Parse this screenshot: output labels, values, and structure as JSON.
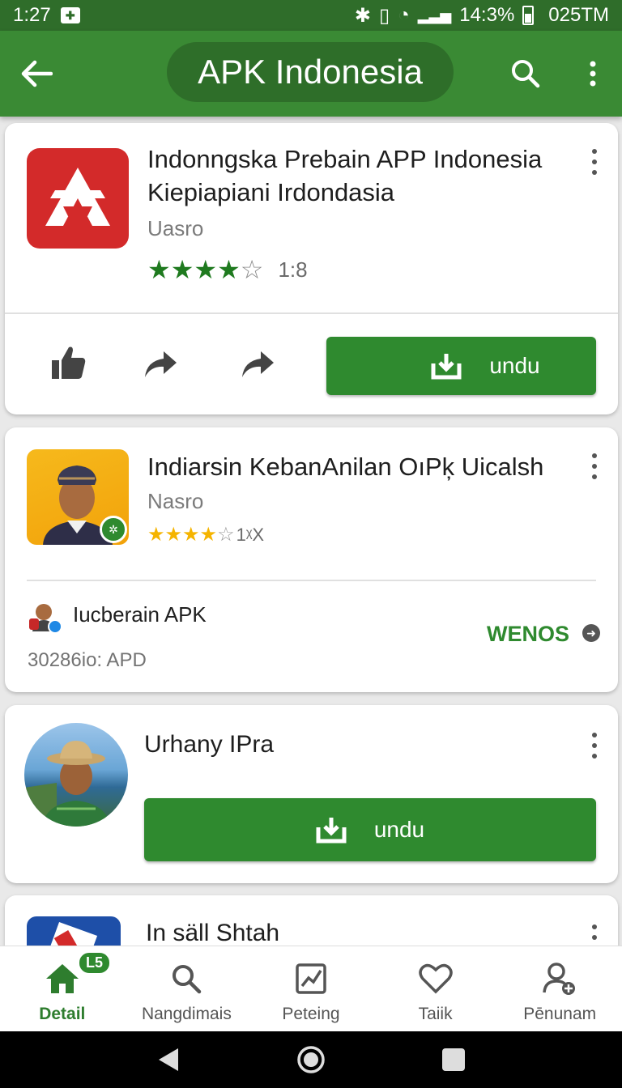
{
  "status_bar": {
    "time": "1:27",
    "battery_percent": "14:3%",
    "clock_right": "025TM"
  },
  "app_bar": {
    "title": "APK Indonesia",
    "icons": [
      "back-arrow-icon",
      "search-icon",
      "more-vert-icon"
    ]
  },
  "cards": [
    {
      "title": "Indonngska Prebain APP Indonesia Kiepiapiani Irdondasia",
      "developer": "Uasro",
      "rating_stars": 4,
      "rating_text": "1:8",
      "actions": [
        "thumb-up-icon",
        "share-icon",
        "forward-icon"
      ],
      "download_label": "undu"
    },
    {
      "title": "Indiarsin KebanAnilan OıPķ Uicalsh",
      "developer": "Nasro",
      "rating_stars": 4,
      "rating_text": "1ᵡX",
      "sub_name": "Iucberain APK",
      "sub_size": "30286io: APD",
      "sub_action": "WENOS"
    },
    {
      "title": "Urhany IPra",
      "download_label": "undu"
    },
    {
      "title": "In säll Shtah"
    }
  ],
  "bottom_nav": {
    "items": [
      {
        "label": "Detail",
        "icon": "home-icon",
        "active": true,
        "badge": "L5"
      },
      {
        "label": "Nangdimais",
        "icon": "search-icon"
      },
      {
        "label": "Peteing",
        "icon": "chart-icon"
      },
      {
        "label": "Taiik",
        "icon": "heart-icon"
      },
      {
        "label": "Pēnunam",
        "icon": "add-user-icon"
      }
    ]
  },
  "colors": {
    "app_bar": "#3a8a34",
    "status_bar": "#2f6d2a",
    "accent_green": "#2f8a2f",
    "star_green": "#1f7a1f",
    "star_yellow": "#f5b400"
  }
}
